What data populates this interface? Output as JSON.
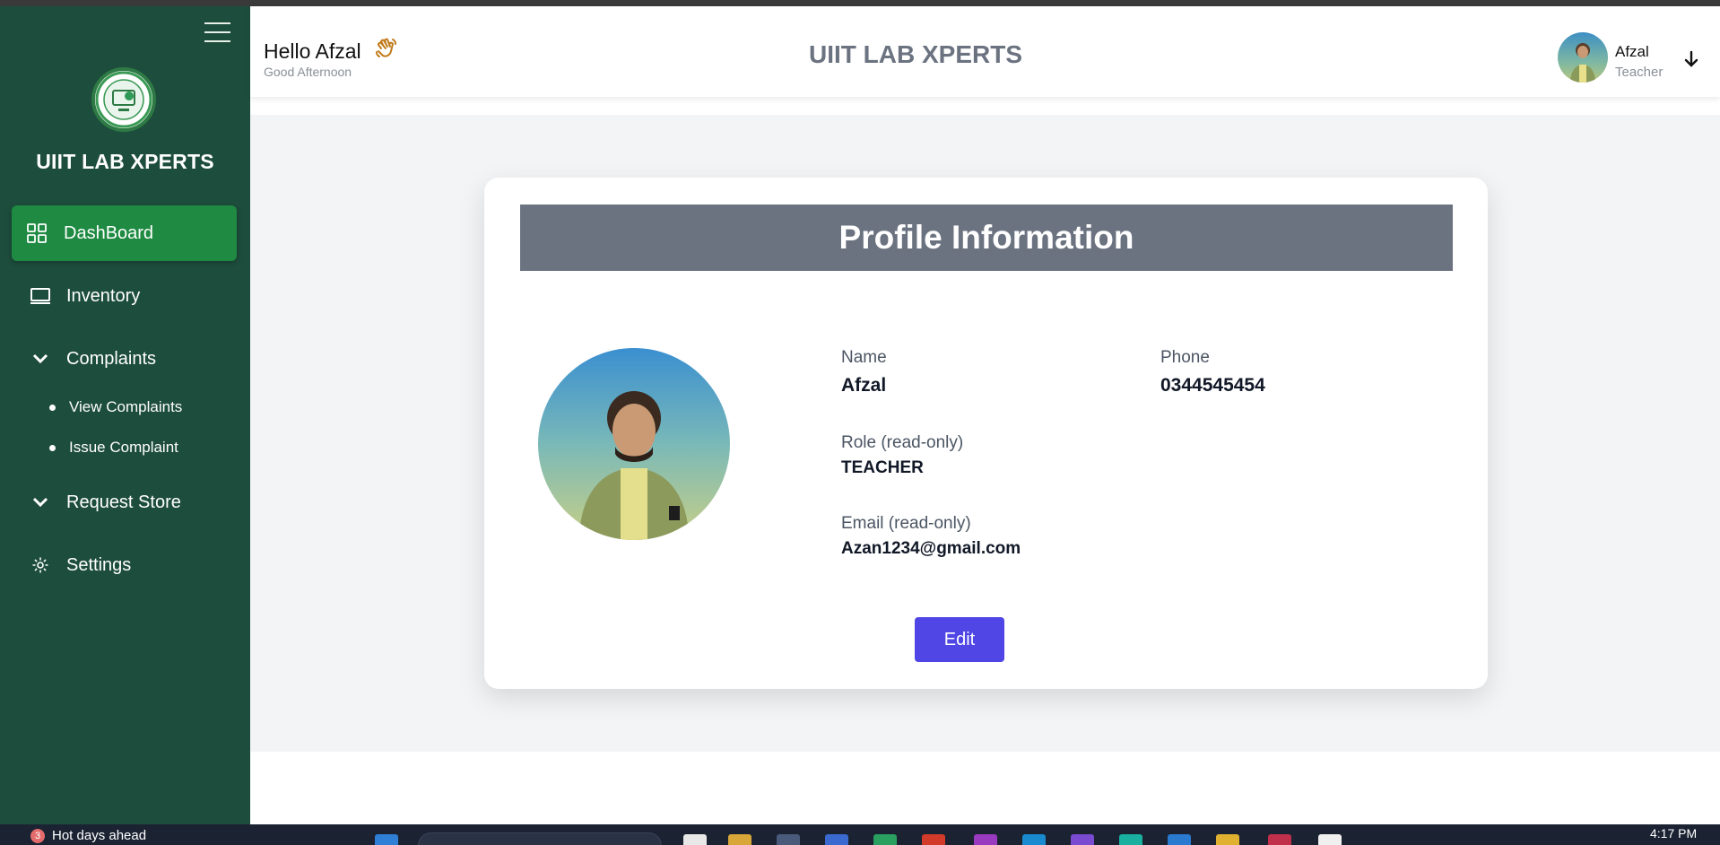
{
  "sidebar": {
    "brand": "UIIT LAB XPERTS",
    "items": {
      "dashboard": "DashBoard",
      "inventory": "Inventory",
      "complaints": "Complaints",
      "view_complaints": "View Complaints",
      "issue_complaint": "Issue Complaint",
      "request_store": "Request Store",
      "settings": "Settings"
    },
    "active_color": "#1e8a42",
    "background_color": "#1d4d3c"
  },
  "header": {
    "greeting": "Hello Afzal",
    "subgreeting": "Good Afternoon",
    "title": "UIIT LAB XPERTS",
    "user_name": "Afzal",
    "user_role": "Teacher"
  },
  "profile": {
    "heading": "Profile Information",
    "name_label": "Name",
    "name_value": "Afzal",
    "phone_label": "Phone",
    "phone_value": "0344545454",
    "role_label": "Role (read-only)",
    "role_value": "TEACHER",
    "email_label": "Email (read-only)",
    "email_value": "Azan1234@gmail.com",
    "edit_label": "Edit",
    "edit_color": "#4f46e5"
  },
  "taskbar": {
    "weather_badge": "3",
    "weather_text": "Hot days ahead",
    "time": "4:17 PM"
  }
}
